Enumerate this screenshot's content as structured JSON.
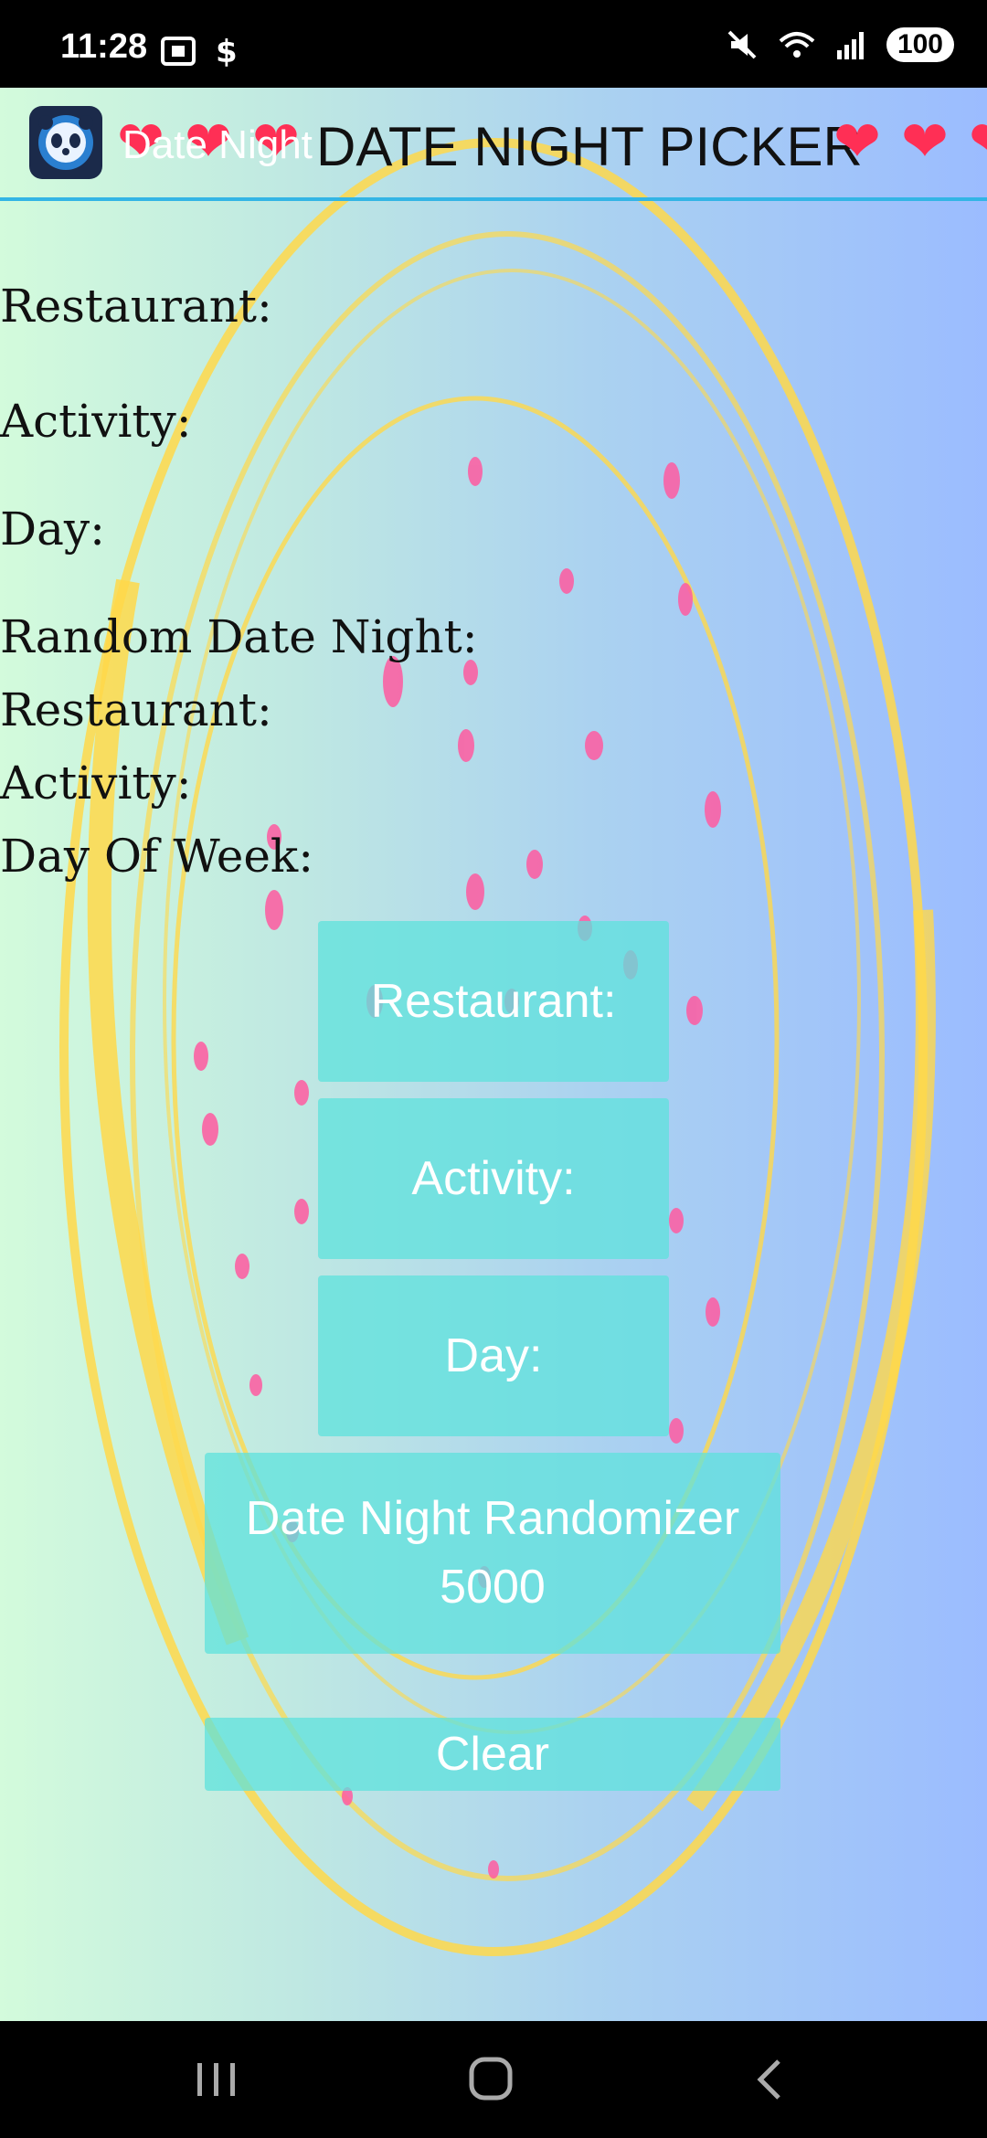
{
  "status": {
    "time": "11:28",
    "battery": "100"
  },
  "header": {
    "app_name": "Date Night",
    "title": "DATE NIGHT PICKER"
  },
  "labels": {
    "restaurant": "Restaurant:",
    "activity": "Activity:",
    "day": "Day:",
    "random_header": "Random Date Night:",
    "random_restaurant": "Restaurant:",
    "random_activity": "Activity:",
    "day_of_week": "Day Of Week:"
  },
  "buttons": {
    "restaurant": "Restaurant:",
    "activity": "Activity:",
    "day": "Day:",
    "randomizer": "Date Night Randomizer 5000",
    "clear": "Clear"
  },
  "colors": {
    "accent": "#33b5e5",
    "button_fill": "#5ee1dc",
    "heart": "#ff2f55",
    "splatter": "#ff5aa0",
    "ring": "#ffd84a"
  }
}
